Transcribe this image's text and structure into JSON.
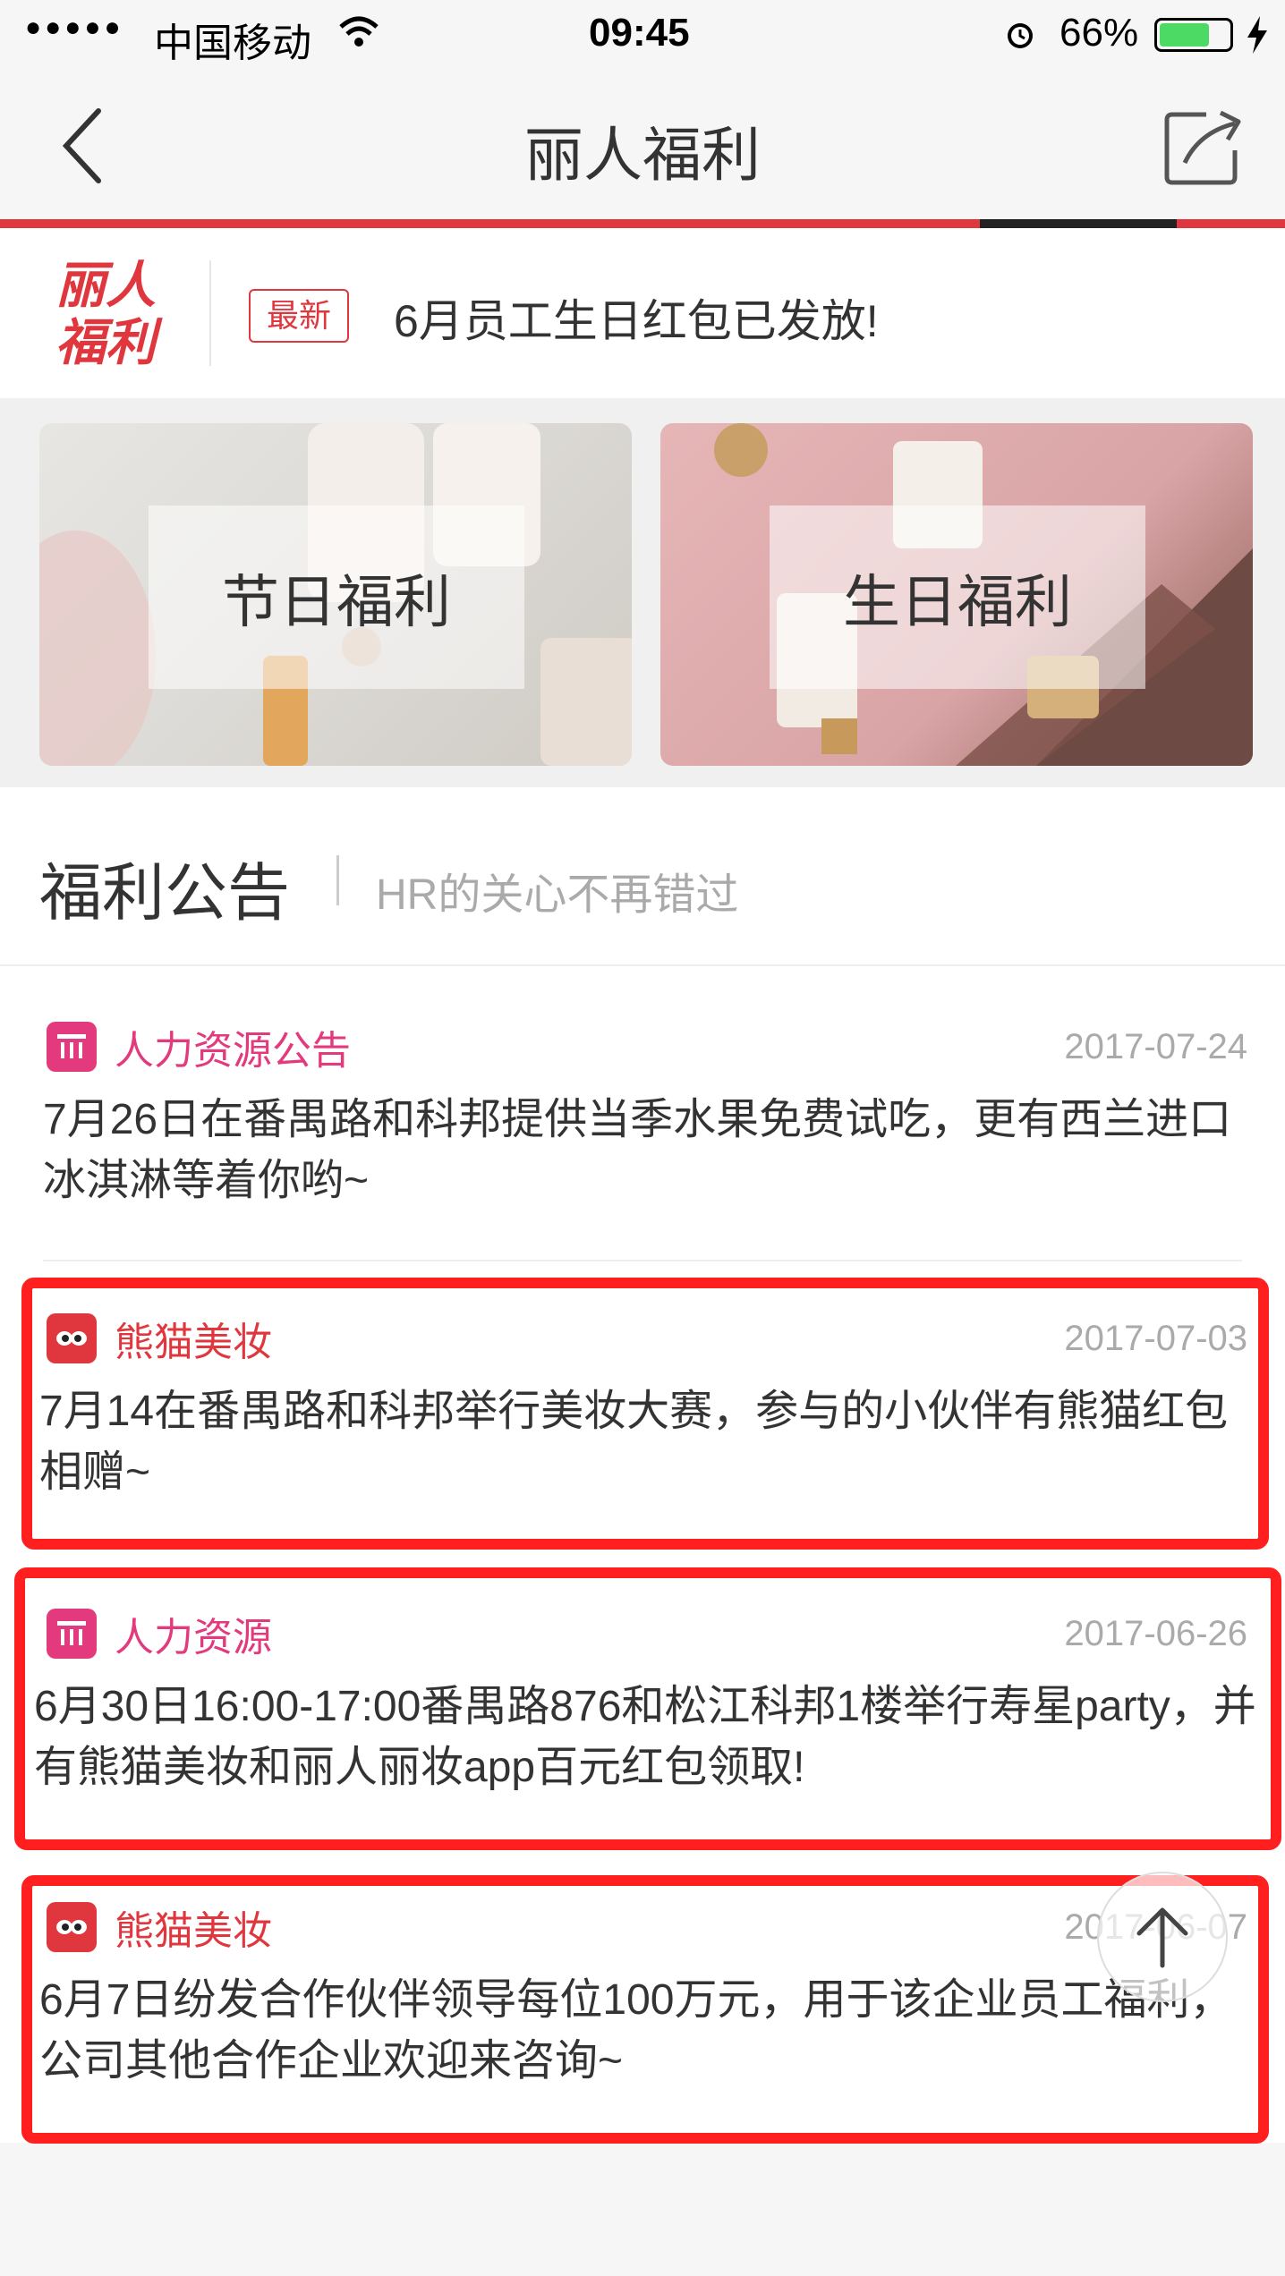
{
  "status": {
    "carrier": "中国移动",
    "time": "09:45",
    "battery": "66%"
  },
  "nav": {
    "title": "丽人福利"
  },
  "banner": {
    "logo_line1": "丽人",
    "logo_line2": "福利",
    "tag": "最新",
    "text": "6月员工生日红包已发放!"
  },
  "cards": [
    {
      "label": "节日福利"
    },
    {
      "label": "生日福利"
    }
  ],
  "section": {
    "title": "福利公告",
    "subtitle": "HR的关心不再错过"
  },
  "items": [
    {
      "source": "人力资源公告",
      "date": "2017-07-24",
      "text": "7月26日在番禺路和科邦提供当季水果免费试吃，更有西兰进口冰淇淋等着你哟~",
      "icon": "hr-icon",
      "color": "#e33a7d"
    },
    {
      "source": "熊猫美妆",
      "date": "2017-07-03",
      "text": "7月14在番禺路和科邦举行美妆大赛，参与的小伙伴有熊猫红包相赠~",
      "icon": "panda-icon",
      "color": "#e0373f"
    },
    {
      "source": "人力资源",
      "date": "2017-06-26",
      "text": "6月30日16:00-17:00番禺路876和松江科邦1楼举行寿星party，并有熊猫美妆和丽人丽妆app百元红包领取!",
      "icon": "hr-icon",
      "color": "#e33a7d"
    },
    {
      "source": "熊猫美妆",
      "date": "2017-06-07",
      "text": "6月7日纷发合作伙伴领导每位100万元，用于该企业员工福利，公司其他合作企业欢迎来咨询~",
      "icon": "panda-icon",
      "color": "#e0373f"
    }
  ],
  "colors": {
    "accent": "#e0373f",
    "hr_pink": "#e33a7d",
    "highlight_red": "#ff1f1f"
  }
}
